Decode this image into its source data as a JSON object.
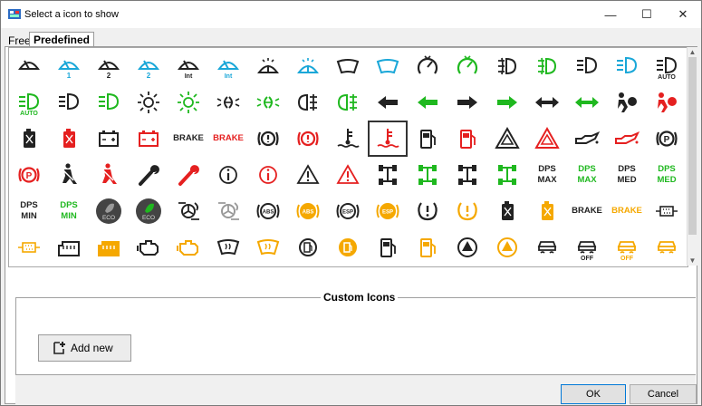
{
  "window": {
    "title": "Select a icon to show",
    "minimize": "—",
    "maximize": "☐",
    "close": "✕"
  },
  "tabs": {
    "free": "Free",
    "predefined": "Predefined"
  },
  "icons": [
    {
      "n": "wiper-icon",
      "g": "wiper",
      "c": "#222"
    },
    {
      "n": "wiper-1-icon",
      "g": "wiper",
      "c": "#1aa7d8",
      "t": "1"
    },
    {
      "n": "wiper-2-icon",
      "g": "wiper",
      "c": "#222",
      "t": "2"
    },
    {
      "n": "wiper-2-blue-icon",
      "g": "wiper",
      "c": "#1aa7d8",
      "t": "2"
    },
    {
      "n": "wiper-int-icon",
      "g": "wiper",
      "c": "#222",
      "t": "Int"
    },
    {
      "n": "wiper-int-blue-icon",
      "g": "wiper",
      "c": "#1aa7d8",
      "t": "Int"
    },
    {
      "n": "washer-icon",
      "g": "washer",
      "c": "#222"
    },
    {
      "n": "washer-blue-icon",
      "g": "washer",
      "c": "#1aa7d8"
    },
    {
      "n": "windshield-icon",
      "g": "windshield",
      "c": "#222"
    },
    {
      "n": "windshield-blue-icon",
      "g": "windshield",
      "c": "#1aa7d8"
    },
    {
      "n": "cruise-icon",
      "g": "gauge",
      "c": "#222"
    },
    {
      "n": "cruise-green-icon",
      "g": "gauge",
      "c": "#1fb81f"
    },
    {
      "n": "fog-light-icon",
      "g": "fog",
      "c": "#222"
    },
    {
      "n": "fog-light-green-icon",
      "g": "fog",
      "c": "#1fb81f"
    },
    {
      "n": "high-beam-icon",
      "g": "beam",
      "c": "#222"
    },
    {
      "n": "high-beam-blue-icon",
      "g": "beam",
      "c": "#1aa7d8"
    },
    {
      "n": "high-beam-auto-icon",
      "g": "beam",
      "c": "#222",
      "t": "AUTO"
    },
    {
      "n": "auto-beam-green-icon",
      "g": "beam",
      "c": "#1fb81f",
      "t": "AUTO"
    },
    {
      "n": "low-beam-icon",
      "g": "beam",
      "c": "#222"
    },
    {
      "n": "low-beam-green-icon",
      "g": "beam",
      "c": "#1fb81f"
    },
    {
      "n": "sun-icon",
      "g": "sun",
      "c": "#222"
    },
    {
      "n": "sun-green-icon",
      "g": "sun",
      "c": "#1fb81f"
    },
    {
      "n": "side-light-icon",
      "g": "sidelight",
      "c": "#222"
    },
    {
      "n": "side-light-green-icon",
      "g": "sidelight",
      "c": "#1fb81f"
    },
    {
      "n": "rear-fog-icon",
      "g": "rearfog",
      "c": "#222"
    },
    {
      "n": "rear-fog-green-icon",
      "g": "rearfog",
      "c": "#1fb81f"
    },
    {
      "n": "arrow-left-icon",
      "g": "aleft",
      "c": "#222"
    },
    {
      "n": "arrow-left-green-icon",
      "g": "aleft",
      "c": "#1fb81f"
    },
    {
      "n": "arrow-right-icon",
      "g": "aright",
      "c": "#222"
    },
    {
      "n": "arrow-right-green-icon",
      "g": "aright",
      "c": "#1fb81f"
    },
    {
      "n": "hazard-arrows-icon",
      "g": "aboth",
      "c": "#222"
    },
    {
      "n": "hazard-arrows-green-icon",
      "g": "aboth",
      "c": "#1fb81f"
    },
    {
      "n": "airbag-icon",
      "g": "airbag",
      "c": "#222"
    },
    {
      "n": "airbag-red-icon",
      "g": "airbag",
      "c": "#e52020"
    },
    {
      "n": "fuel-can-icon",
      "g": "can",
      "c": "#222"
    },
    {
      "n": "fuel-can-red-icon",
      "g": "can",
      "c": "#e52020"
    },
    {
      "n": "battery-icon",
      "g": "battery",
      "c": "#222"
    },
    {
      "n": "battery-red-icon",
      "g": "battery",
      "c": "#e52020"
    },
    {
      "n": "brake-text-icon",
      "g": "text",
      "c": "#222",
      "t": "BRAKE"
    },
    {
      "n": "brake-text-red-icon",
      "g": "text",
      "c": "#e52020",
      "t": "BRAKE"
    },
    {
      "n": "brake-warning-icon",
      "g": "brakecircle",
      "c": "#222"
    },
    {
      "n": "brake-warning-red-icon",
      "g": "brakecircle",
      "c": "#e52020"
    },
    {
      "n": "coolant-icon",
      "g": "coolant",
      "c": "#222"
    },
    {
      "n": "coolant-red-icon",
      "g": "coolant",
      "c": "#e52020",
      "sel": true
    },
    {
      "n": "fuel-pump-icon",
      "g": "pump",
      "c": "#222"
    },
    {
      "n": "fuel-pump-red-icon",
      "g": "pump",
      "c": "#e52020"
    },
    {
      "n": "warning-triangle-icon",
      "g": "tri2",
      "c": "#222"
    },
    {
      "n": "warning-triangle-red-icon",
      "g": "tri2",
      "c": "#e52020"
    },
    {
      "n": "oil-icon",
      "g": "oil",
      "c": "#222"
    },
    {
      "n": "oil-red-icon",
      "g": "oil",
      "c": "#e52020"
    },
    {
      "n": "parking-brake-icon",
      "g": "parking",
      "c": "#222"
    },
    {
      "n": "parking-brake-red-icon",
      "g": "parking",
      "c": "#e52020"
    },
    {
      "n": "seatbelt-icon",
      "g": "seatbelt",
      "c": "#222"
    },
    {
      "n": "seatbelt-red-icon",
      "g": "seatbelt",
      "c": "#e52020"
    },
    {
      "n": "wrench-icon",
      "g": "wrench",
      "c": "#222"
    },
    {
      "n": "wrench-red-icon",
      "g": "wrench",
      "c": "#e52020"
    },
    {
      "n": "info-icon",
      "g": "info",
      "c": "#222"
    },
    {
      "n": "info-red-icon",
      "g": "info",
      "c": "#e52020"
    },
    {
      "n": "caution-icon",
      "g": "caution",
      "c": "#222"
    },
    {
      "n": "caution-red-icon",
      "g": "caution",
      "c": "#e52020"
    },
    {
      "n": "axle-icon",
      "g": "axle",
      "c": "#222"
    },
    {
      "n": "axle-green-icon",
      "g": "axle",
      "c": "#1fb81f"
    },
    {
      "n": "axle-lock-icon",
      "g": "axle",
      "c": "#222"
    },
    {
      "n": "axle-lock-green-icon",
      "g": "axle",
      "c": "#1fb81f"
    },
    {
      "n": "dps-max-icon",
      "g": "text2",
      "c": "#222",
      "t": "DPS",
      "t2": "MAX"
    },
    {
      "n": "dps-max-green-icon",
      "g": "text2",
      "c": "#1fb81f",
      "t": "DPS",
      "t2": "MAX"
    },
    {
      "n": "dps-med-icon",
      "g": "text2",
      "c": "#222",
      "t": "DPS",
      "t2": "MED"
    },
    {
      "n": "dps-med-green-icon",
      "g": "text2",
      "c": "#1fb81f",
      "t": "DPS",
      "t2": "MED"
    },
    {
      "n": "dps-min-icon",
      "g": "text2",
      "c": "#222",
      "t": "DPS",
      "t2": "MIN"
    },
    {
      "n": "dps-min-green-icon",
      "g": "text2",
      "c": "#1fb81f",
      "t": "DPS",
      "t2": "MIN"
    },
    {
      "n": "eco-icon",
      "g": "eco",
      "c": "#222",
      "t": "ECO"
    },
    {
      "n": "eco-green-icon",
      "g": "eco",
      "c": "#1fb81f",
      "t": "ECO"
    },
    {
      "n": "turbo-icon",
      "g": "turbo",
      "c": "#222"
    },
    {
      "n": "turbo-grey-icon",
      "g": "turbo",
      "c": "#999"
    },
    {
      "n": "abs-icon",
      "g": "abs",
      "c": "#222",
      "t": "ABS"
    },
    {
      "n": "abs-orange-icon",
      "g": "abs",
      "c": "#f5a800",
      "t": "ABS"
    },
    {
      "n": "esp-icon",
      "g": "abs",
      "c": "#222",
      "t": "ESP"
    },
    {
      "n": "esp-orange-icon",
      "g": "abs",
      "c": "#f5a800",
      "t": "ESP"
    },
    {
      "n": "tpms-icon",
      "g": "tpms",
      "c": "#222"
    },
    {
      "n": "tpms-orange-icon",
      "g": "tpms",
      "c": "#f5a800"
    },
    {
      "n": "fuel-can-small-icon",
      "g": "can",
      "c": "#222"
    },
    {
      "n": "fuel-can-orange-icon",
      "g": "can",
      "c": "#f5a800"
    },
    {
      "n": "brake-text-plain-icon",
      "g": "text",
      "c": "#222",
      "t": "BRAKE"
    },
    {
      "n": "brake-text-orange-icon",
      "g": "text",
      "c": "#f5a800",
      "t": "BRAKE"
    },
    {
      "n": "dpf-icon",
      "g": "dpf",
      "c": "#222"
    },
    {
      "n": "dpf-orange-icon",
      "g": "dpf",
      "c": "#f5a800"
    },
    {
      "n": "factory-icon",
      "g": "factory",
      "c": "#222"
    },
    {
      "n": "factory-orange-icon",
      "g": "factory",
      "c": "#f5a800"
    },
    {
      "n": "engine-icon",
      "g": "engine",
      "c": "#222"
    },
    {
      "n": "engine-orange-icon",
      "g": "engine",
      "c": "#f5a800"
    },
    {
      "n": "windshield-heat-icon",
      "g": "wsheat",
      "c": "#222"
    },
    {
      "n": "windshield-heat-orange-icon",
      "g": "wsheat",
      "c": "#f5a800"
    },
    {
      "n": "fuel-circle-icon",
      "g": "fuelcircle",
      "c": "#222"
    },
    {
      "n": "fuel-circle-orange-icon",
      "g": "fuelcircle",
      "c": "#f5a800"
    },
    {
      "n": "fuel-pump-plain-icon",
      "g": "pump",
      "c": "#222"
    },
    {
      "n": "fuel-pump-orange-icon",
      "g": "pump",
      "c": "#f5a800"
    },
    {
      "n": "triangle-circle-icon",
      "g": "tricircle",
      "c": "#222"
    },
    {
      "n": "triangle-circle-orange-icon",
      "g": "tricircle",
      "c": "#f5a800"
    },
    {
      "n": "traction-icon",
      "g": "traction",
      "c": "#222"
    },
    {
      "n": "traction-off-icon",
      "g": "traction",
      "c": "#222",
      "t": "OFF"
    },
    {
      "n": "traction-off-orange-icon",
      "g": "traction",
      "c": "#f5a800",
      "t": "OFF"
    },
    {
      "n": "traction-orange-icon",
      "g": "traction",
      "c": "#f5a800"
    }
  ],
  "custom_icons": {
    "label": "Custom Icons",
    "add_button": "Add new"
  },
  "footer": {
    "ok": "OK",
    "cancel": "Cancel"
  },
  "colors": {
    "green": "#1fb81f",
    "blue": "#1aa7d8",
    "red": "#e52020",
    "orange": "#f5a800"
  }
}
